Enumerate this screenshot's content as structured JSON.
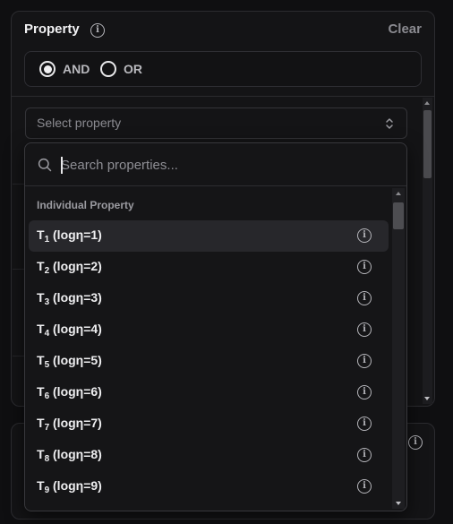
{
  "panel": {
    "title": "Property",
    "clear_label": "Clear",
    "logic": {
      "options": [
        {
          "label": "AND",
          "selected": true
        },
        {
          "label": "OR",
          "selected": false
        }
      ]
    },
    "select_placeholder": "Select property"
  },
  "dropdown": {
    "search_placeholder": "Search properties...",
    "group_label": "Individual Property",
    "items": [
      {
        "base": "T",
        "sub": "1",
        "rest": " (logη=1)"
      },
      {
        "base": "T",
        "sub": "2",
        "rest": " (logη=2)"
      },
      {
        "base": "T",
        "sub": "3",
        "rest": " (logη=3)"
      },
      {
        "base": "T",
        "sub": "4",
        "rest": " (logη=4)"
      },
      {
        "base": "T",
        "sub": "5",
        "rest": " (logη=5)"
      },
      {
        "base": "T",
        "sub": "6",
        "rest": " (logη=6)"
      },
      {
        "base": "T",
        "sub": "7",
        "rest": " (logη=7)"
      },
      {
        "base": "T",
        "sub": "8",
        "rest": " (logη=8)"
      },
      {
        "base": "T",
        "sub": "9",
        "rest": " (logη=9)"
      }
    ],
    "highlighted_index": 0
  },
  "icons": {
    "info": "info-icon",
    "search": "search-icon",
    "chevron": "chevron-up-down-icon"
  },
  "colors": {
    "background": "#0f0f11",
    "panel": "#141416",
    "border": "#2c2c30",
    "highlight": "#27272b",
    "text": "#efeff1",
    "muted": "#8b8b91"
  }
}
